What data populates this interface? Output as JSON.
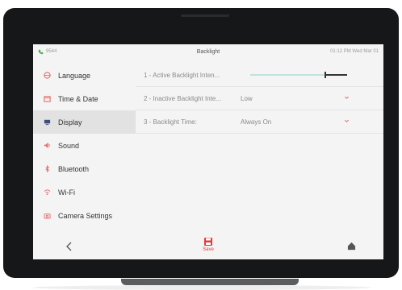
{
  "statusbar": {
    "extension": "9544",
    "title": "Backlight",
    "datetime": "01:12 PM Wed Mar 01"
  },
  "sidebar": {
    "items": [
      {
        "label": "Language",
        "icon": "globe-icon"
      },
      {
        "label": "Time & Date",
        "icon": "calendar-icon"
      },
      {
        "label": "Display",
        "icon": "monitor-icon",
        "active": true
      },
      {
        "label": "Sound",
        "icon": "speaker-icon"
      },
      {
        "label": "Bluetooth",
        "icon": "bluetooth-icon"
      },
      {
        "label": "Wi-Fi",
        "icon": "wifi-icon"
      },
      {
        "label": "Camera Settings",
        "icon": "camera-icon"
      }
    ]
  },
  "settings": {
    "rows": [
      {
        "label": "1 - Active Backlight Inten...",
        "slider_level": 0.77
      },
      {
        "label": "2 - Inactive Backlight Inte...",
        "value": "Low"
      },
      {
        "label": "3 - Backlight Time:",
        "value": "Always On"
      }
    ]
  },
  "bottombar": {
    "save_label": "Save"
  },
  "colors": {
    "accent_red": "#e23a3a",
    "phone_green": "#4caf50",
    "slider_track": "#bfe3de"
  }
}
